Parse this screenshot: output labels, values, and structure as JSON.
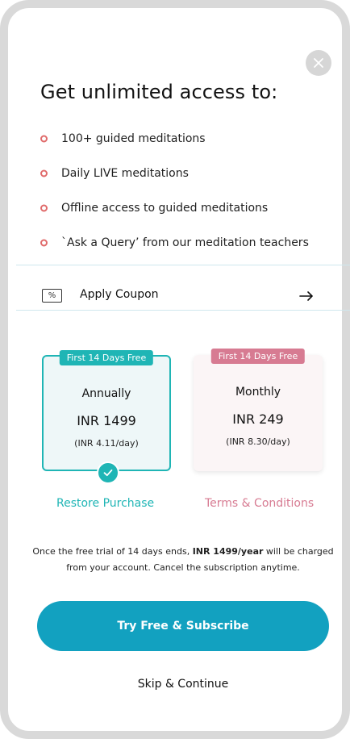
{
  "header": {
    "close_icon": "close-icon",
    "headline": "Get unlimited access to:"
  },
  "benefits": [
    {
      "text": "100+ guided meditations"
    },
    {
      "text": "Daily LIVE meditations"
    },
    {
      "text": "Offline access to guided meditations"
    },
    {
      "text": "`Ask a Query’ from our meditation teachers"
    }
  ],
  "coupon": {
    "icon_text": "%",
    "label": "Apply Coupon",
    "arrow_icon": "arrow-right-icon"
  },
  "plans": {
    "annual": {
      "badge": "First 14 Days Free",
      "name": "Annually",
      "price": "INR  1499",
      "per_day": "(INR 4.11/day)",
      "selected": true
    },
    "monthly": {
      "badge": "First 14 Days Free",
      "name": "Monthly",
      "price": "INR  249",
      "per_day": "(INR 8.30/day)",
      "selected": false
    }
  },
  "links": {
    "restore": "Restore Purchase",
    "terms": "Terms & Conditions"
  },
  "disclaimer": {
    "prefix": "Once the free trial of 14 days ends, ",
    "emphasis": "INR 1499/year",
    "suffix": " will be charged from your account. Cancel the subscription anytime."
  },
  "cta": {
    "label": "Try Free & Subscribe"
  },
  "skip": {
    "label": "Skip & Continue"
  },
  "colors": {
    "accent_teal": "#1fb5b5",
    "accent_pink": "#d77b92",
    "cta_blue": "#12a1c0",
    "bullet_red": "#e06b6b"
  }
}
